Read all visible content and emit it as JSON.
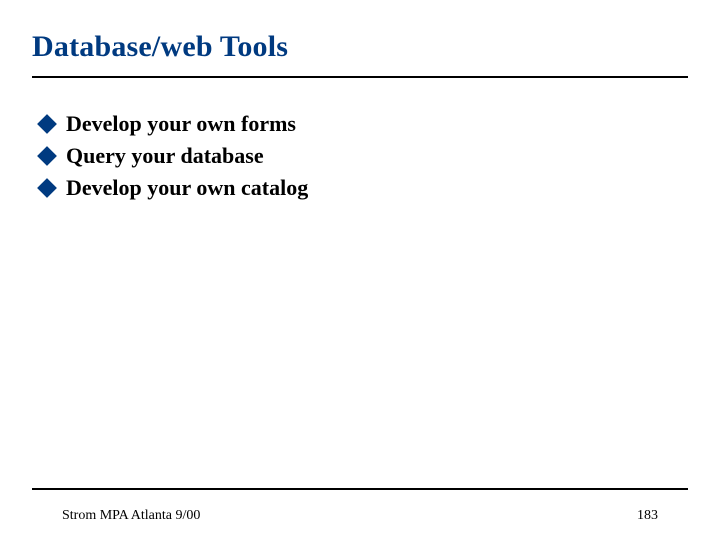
{
  "title": "Database/web Tools",
  "bullets": [
    {
      "label": "Develop your own forms"
    },
    {
      "label": "Query your database"
    },
    {
      "label": "Develop your own catalog"
    }
  ],
  "footer": {
    "left": "Strom MPA Atlanta 9/00",
    "right": "183"
  }
}
